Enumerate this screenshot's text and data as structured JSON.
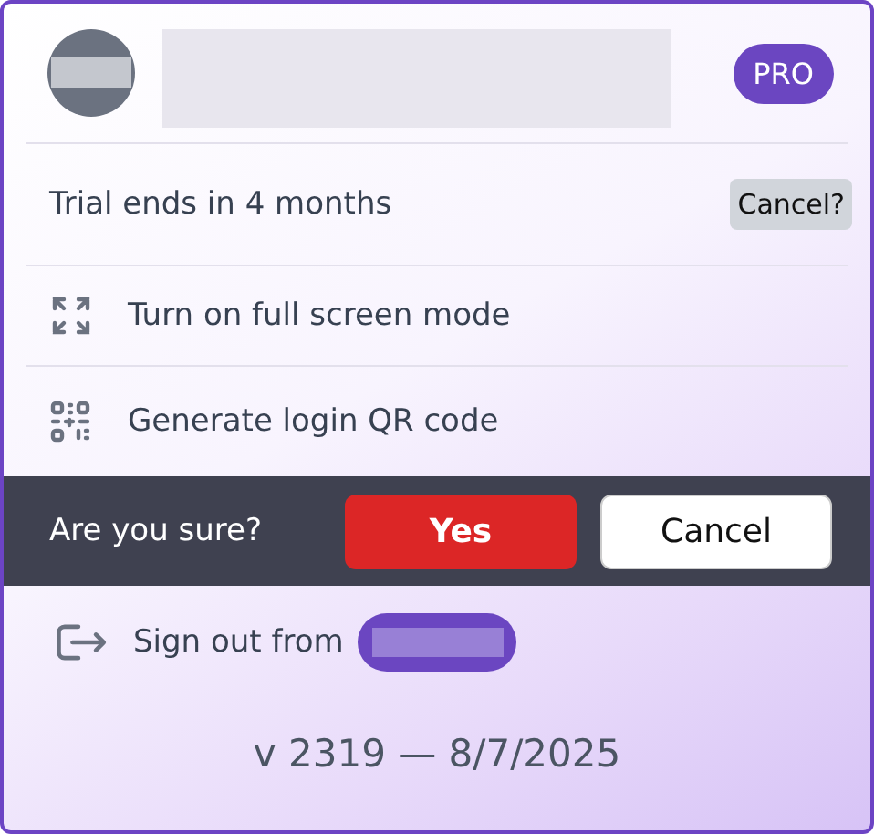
{
  "header": {
    "badge": "PRO"
  },
  "trial": {
    "text": "Trial ends in 4 months",
    "button": "Cancel?"
  },
  "menu": [
    {
      "kind": "fullscreen",
      "label": "Turn on full screen mode"
    },
    {
      "kind": "qr",
      "label": "Generate login QR code"
    }
  ],
  "confirm": {
    "question": "Are you sure?",
    "buttons": [
      {
        "kind": "confirm",
        "label": "Yes"
      },
      {
        "kind": "cancel",
        "label": "Cancel"
      }
    ]
  },
  "signout": {
    "label": "Sign out from"
  },
  "version": "v 2319 — 8/7/2025"
}
